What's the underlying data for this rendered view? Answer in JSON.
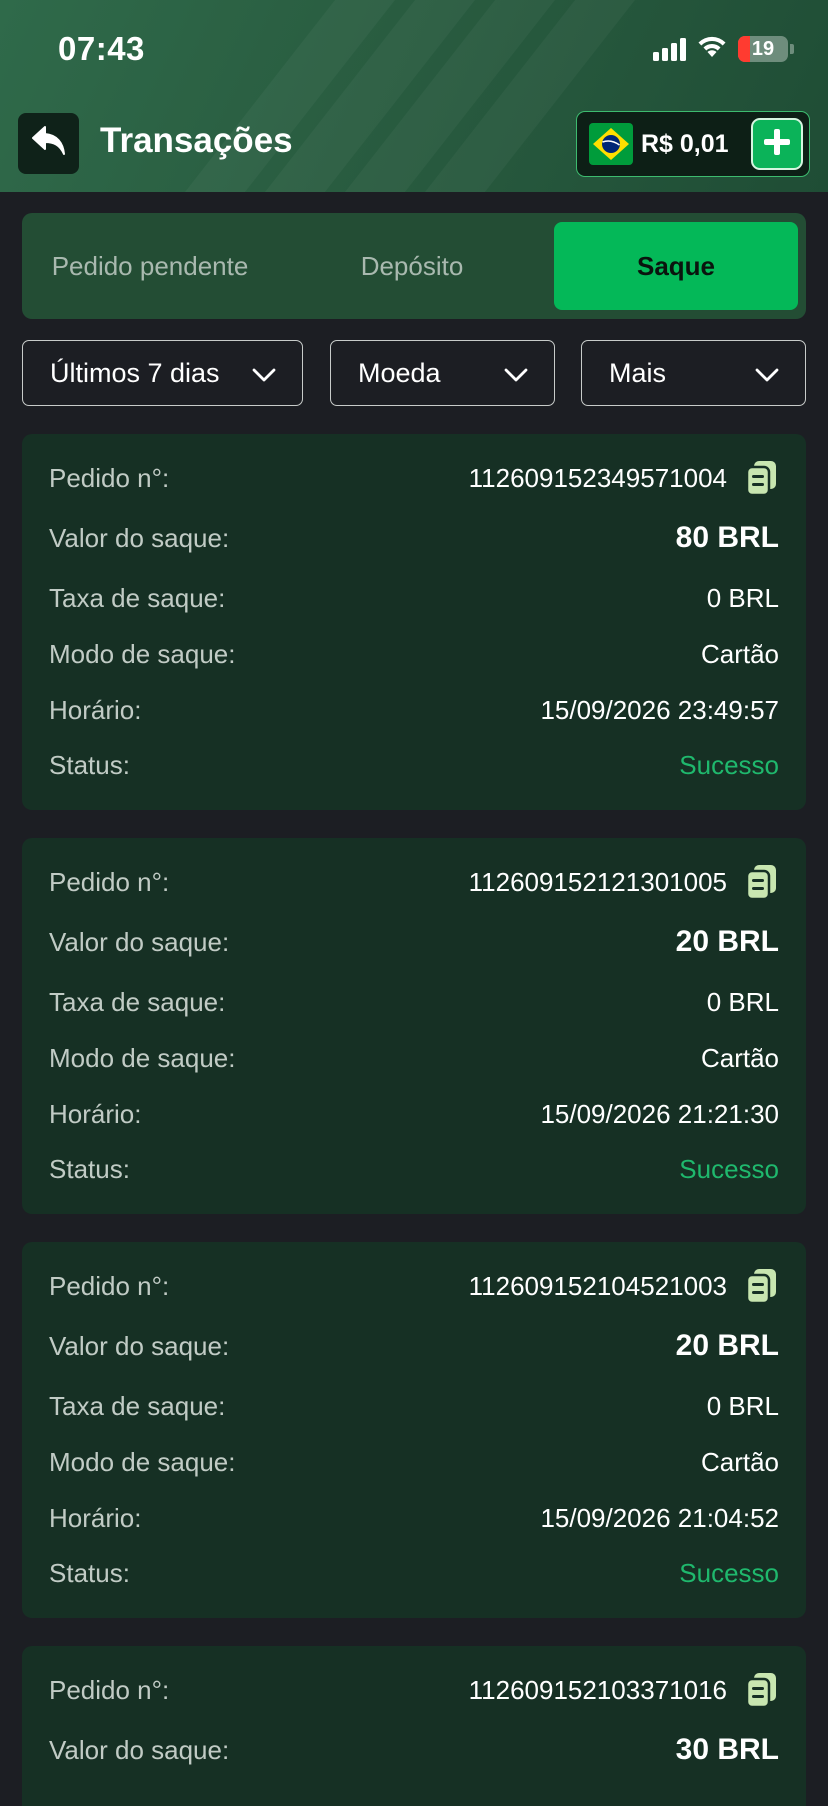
{
  "status_bar": {
    "time": "07:43",
    "battery": "19"
  },
  "header": {
    "title": "Transações",
    "balance": "R$ 0,01"
  },
  "tabs": [
    {
      "label": "Pedido pendente",
      "active": false
    },
    {
      "label": "Depósito",
      "active": false
    },
    {
      "label": "Saque",
      "active": true
    }
  ],
  "filters": [
    {
      "label": "Últimos 7 dias"
    },
    {
      "label": "Moeda"
    },
    {
      "label": "Mais"
    }
  ],
  "labels": {
    "order": "Pedido n°:",
    "amount": "Valor do saque:",
    "fee": "Taxa de saque:",
    "mode": "Modo de saque:",
    "time": "Horário:",
    "status": "Status:"
  },
  "transactions": [
    {
      "order_no": "112609152349571004",
      "amount": "80 BRL",
      "fee": "0 BRL",
      "mode": "Cartão",
      "time": "15/09/2026 23:49:57",
      "status": "Sucesso"
    },
    {
      "order_no": "112609152121301005",
      "amount": "20 BRL",
      "fee": "0 BRL",
      "mode": "Cartão",
      "time": "15/09/2026 21:21:30",
      "status": "Sucesso"
    },
    {
      "order_no": "112609152104521003",
      "amount": "20 BRL",
      "fee": "0 BRL",
      "mode": "Cartão",
      "time": "15/09/2026 21:04:52",
      "status": "Sucesso"
    },
    {
      "order_no": "112609152103371016",
      "amount": "30 BRL"
    }
  ],
  "colors": {
    "accent": "#04b858",
    "success": "#1fb86d",
    "card": "#163024",
    "background": "#1c1e23"
  },
  "icons": [
    "back-arrow-icon",
    "brazil-flag-icon",
    "plus-icon",
    "chevron-down-icon",
    "copy-icon",
    "wifi-icon",
    "signal-icon",
    "battery-icon"
  ]
}
